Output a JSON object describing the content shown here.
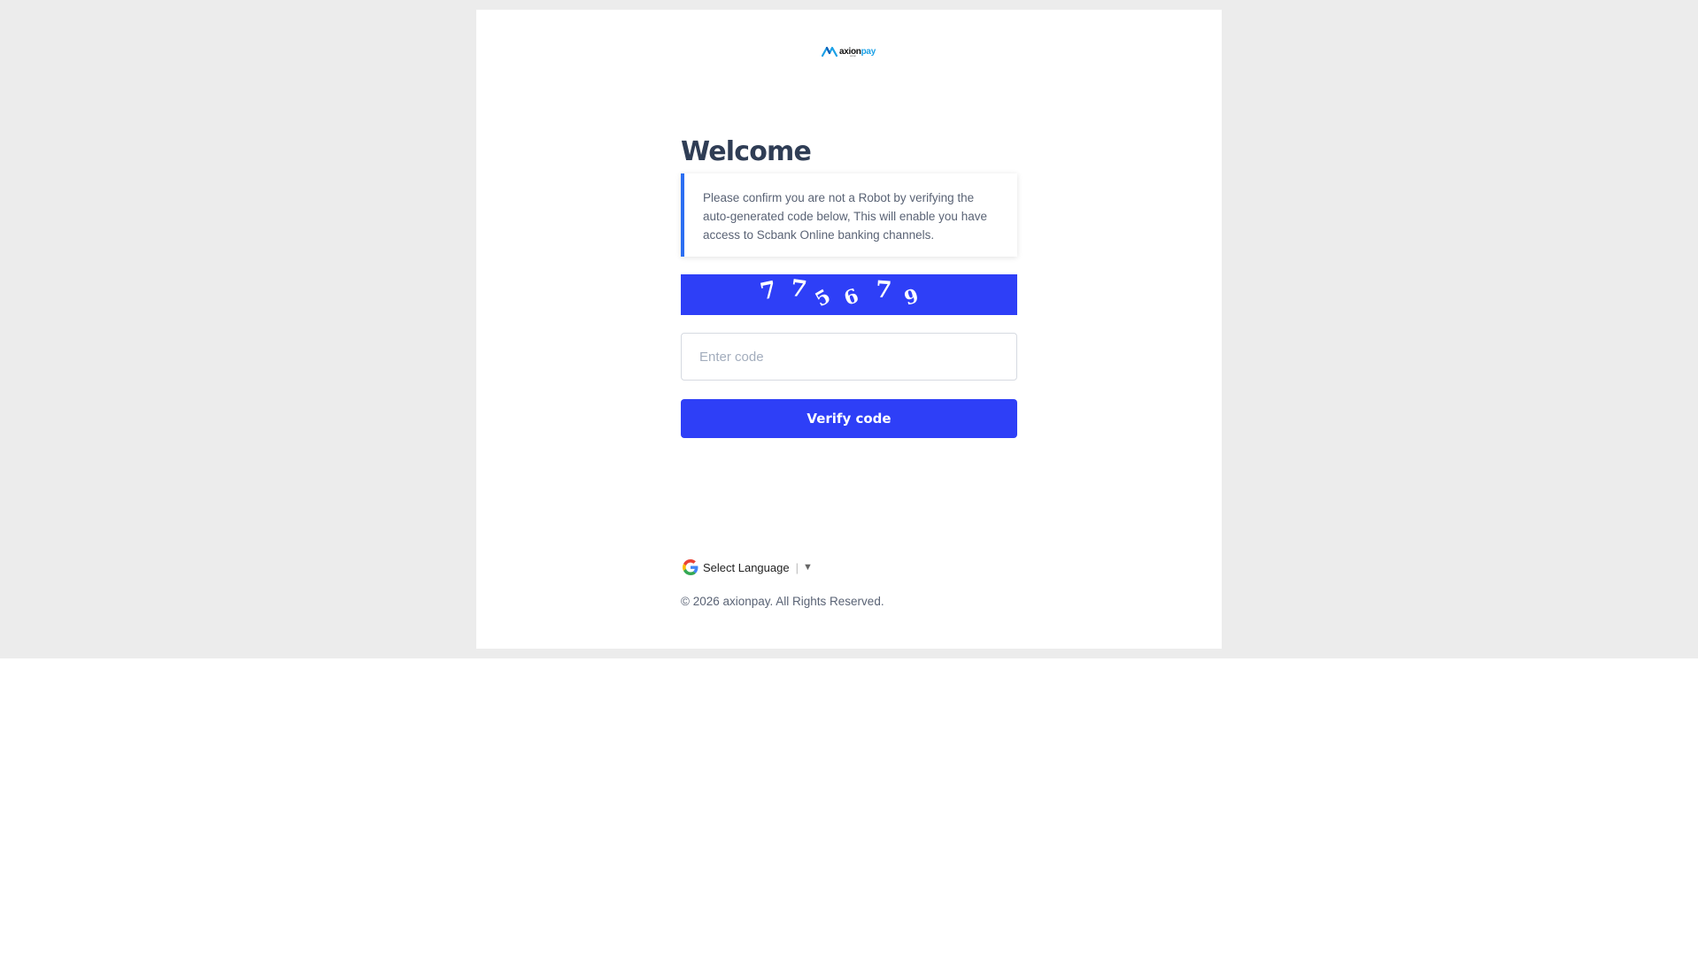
{
  "logo": {
    "brand_main": "axion",
    "brand_accent": "pay",
    "tagline": "axion"
  },
  "page": {
    "title": "Welcome",
    "notice": "Please confirm you are not a Robot by verifying the auto-generated code below, This will enable you have access to Scbank Online banking channels."
  },
  "captcha": {
    "chars": [
      "7",
      "7",
      "5",
      "6",
      "7",
      "9"
    ]
  },
  "form": {
    "code_placeholder": "Enter code",
    "code_value": "",
    "verify_label": "Verify code"
  },
  "language": {
    "label": "Select Language",
    "separator": "|",
    "arrow": "▼"
  },
  "footer": {
    "copyright": "© 2026 axionpay. All Rights Reserved."
  },
  "colors": {
    "primary": "#2e3ff7",
    "notice_border": "#2b6ef2",
    "title": "#2f3d55",
    "backdrop": "#ececec"
  }
}
